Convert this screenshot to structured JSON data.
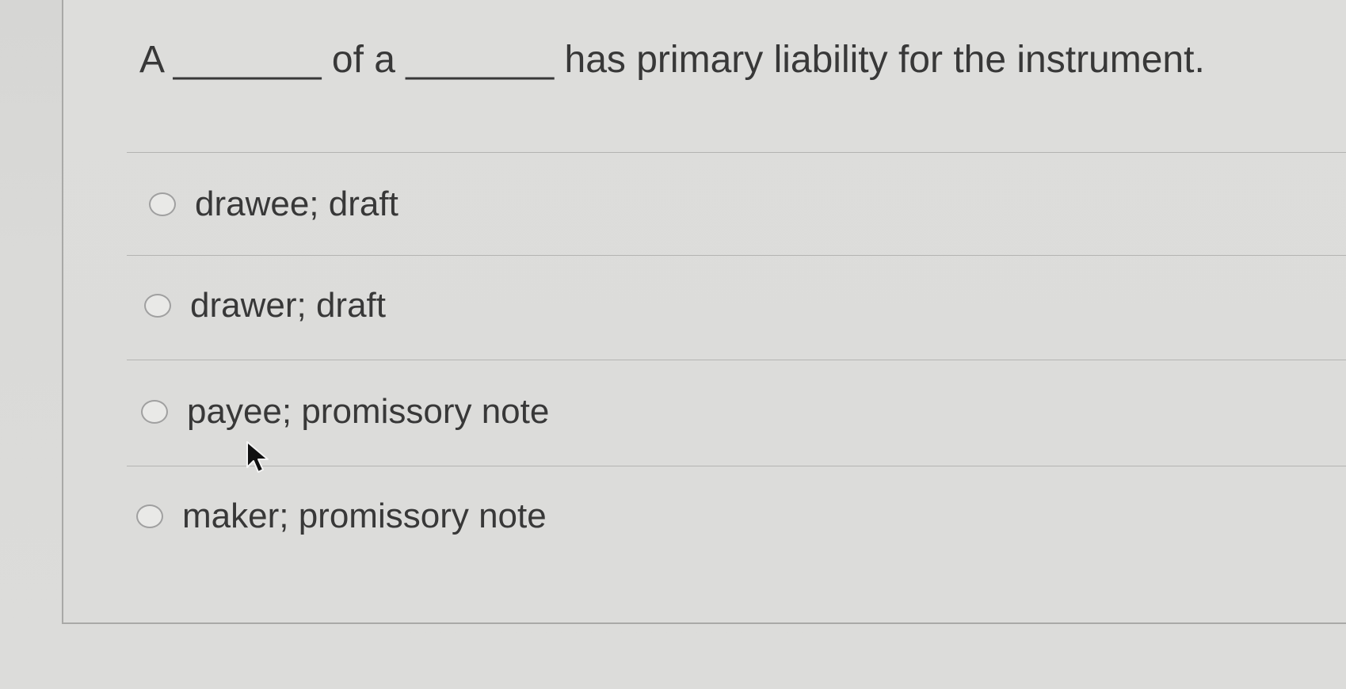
{
  "question": {
    "text": "A _______ of a _______ has primary liability for the instrument."
  },
  "options": [
    {
      "label": "drawee; draft",
      "selected": false
    },
    {
      "label": "drawer; draft",
      "selected": false
    },
    {
      "label": "payee; promissory note",
      "selected": false
    },
    {
      "label": "maker; promissory note",
      "selected": false
    }
  ],
  "cursor_icon": "mouse-pointer-icon"
}
